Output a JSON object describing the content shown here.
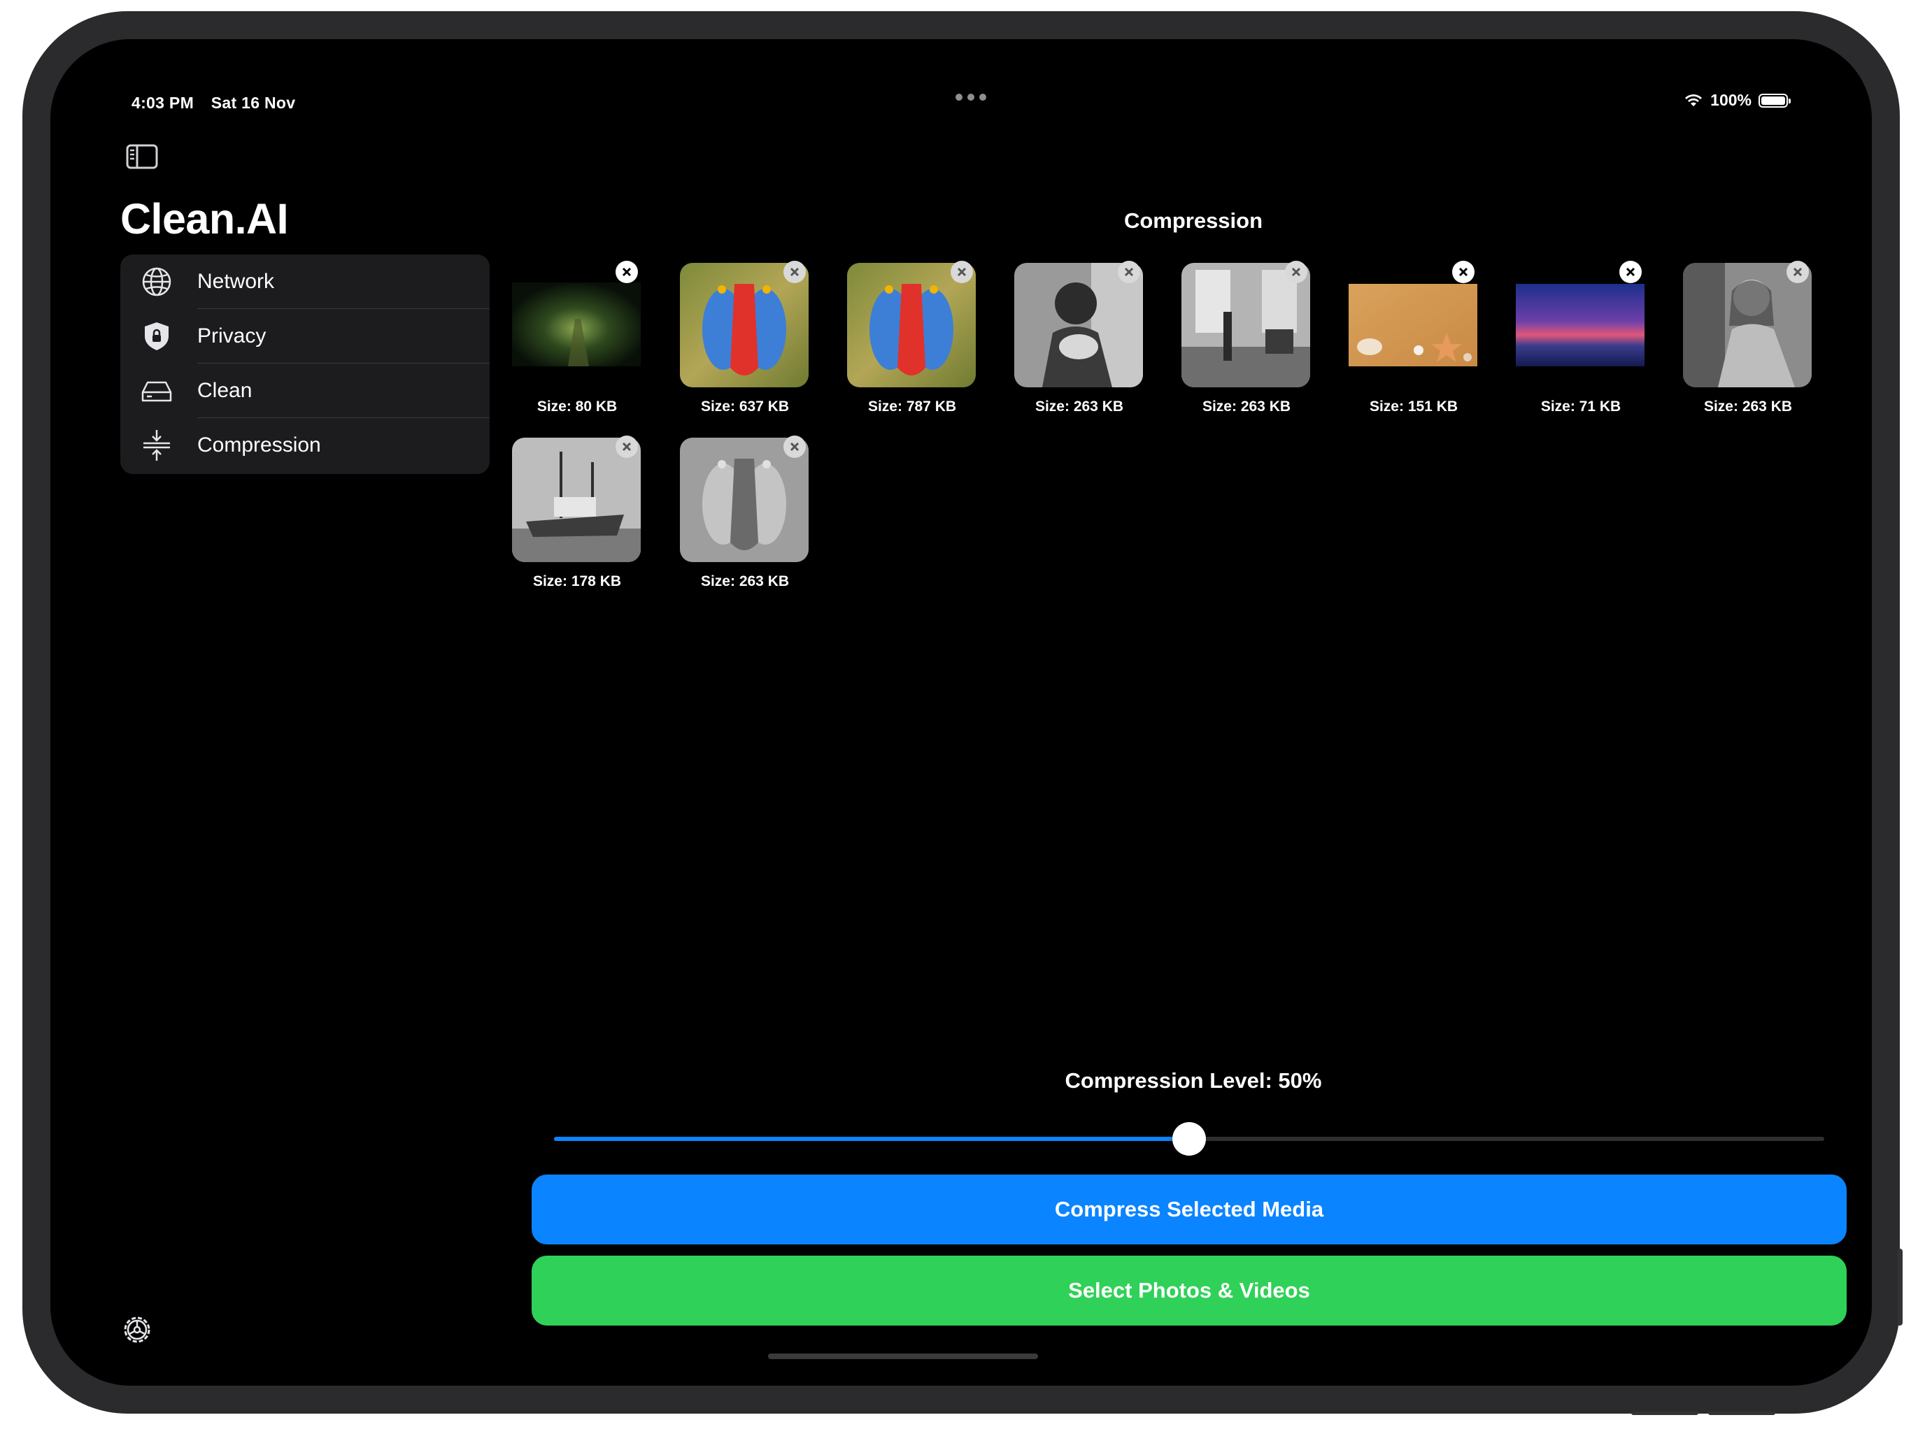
{
  "status_bar": {
    "time": "4:03 PM",
    "date": "Sat 16 Nov",
    "battery": "100%"
  },
  "sidebar": {
    "app_title": "Clean.AI",
    "items": [
      {
        "label": "Network",
        "icon": "globe-icon"
      },
      {
        "label": "Privacy",
        "icon": "shield-lock-icon"
      },
      {
        "label": "Clean",
        "icon": "drive-icon"
      },
      {
        "label": "Compression",
        "icon": "compress-icon"
      }
    ]
  },
  "main": {
    "title": "Compression",
    "media": [
      {
        "size": "Size: 80 KB",
        "subject": "forest path"
      },
      {
        "size": "Size: 637 KB",
        "subject": "mandrill"
      },
      {
        "size": "Size: 787 KB",
        "subject": "mandrill"
      },
      {
        "size": "Size: 263 KB",
        "subject": "grayscale portrait"
      },
      {
        "size": "Size: 263 KB",
        "subject": "grayscale interior"
      },
      {
        "size": "Size: 151 KB",
        "subject": "sand and seashells"
      },
      {
        "size": "Size: 71 KB",
        "subject": "sunset sea"
      },
      {
        "size": "Size: 263 KB",
        "subject": "grayscale portrait"
      },
      {
        "size": "Size: 178 KB",
        "subject": "grayscale boats"
      },
      {
        "size": "Size: 263 KB",
        "subject": "grayscale mandrill"
      }
    ],
    "compression_level_label": "Compression Level: 50%",
    "compression_level": 0.5,
    "compress_button": "Compress Selected Media",
    "select_button": "Select Photos & Videos"
  },
  "colors": {
    "accent_blue": "#0a84ff",
    "accent_green": "#30d158",
    "background": "#000000",
    "sidebar_bg": "#1c1c1e"
  }
}
